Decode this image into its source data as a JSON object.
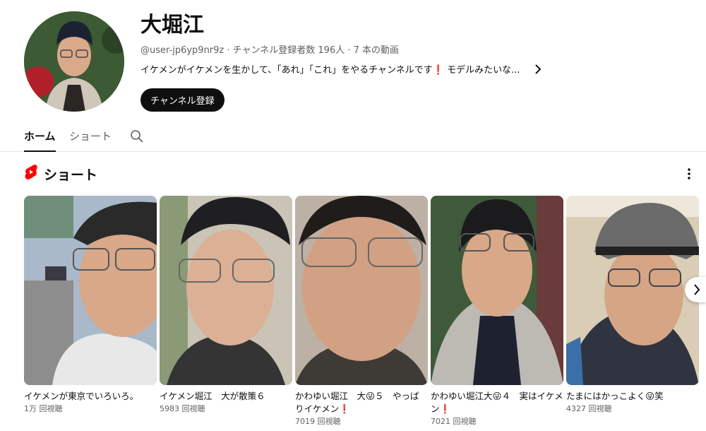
{
  "channel": {
    "name": "大堀江",
    "meta": "@user-jp6yp9nr9z · チャンネル登録者数 196人 · 7 本の動画",
    "description": "イケメンがイケメンを生かして、「あれ」「これ」をやるチャンネルです❗ モデルみたいな...",
    "more_icon": "chevron-right-icon",
    "subscribe_label": "チャンネル登録"
  },
  "tabs": [
    {
      "label": "ホーム",
      "active": true
    },
    {
      "label": "ショート",
      "active": false
    }
  ],
  "search_icon": "search-icon",
  "shorts_section": {
    "title": "ショート",
    "icon": "youtube-shorts-icon",
    "menu_icon": "more-vert-icon",
    "items": [
      {
        "title": "イケメンが東京でいろいろ。",
        "views": "1万 回視聴"
      },
      {
        "title": "イケメン堀江　大が散策６",
        "views": "5983 回視聴"
      },
      {
        "title": "かわゆい堀江　大😜５　やっぱりイケメン❗",
        "views": "7019 回視聴"
      },
      {
        "title": "かわゆい堀江大😜４　実はイケメン❗",
        "views": "7021 回視聴"
      },
      {
        "title": "たまにはかっこよく😜笑",
        "views": "4327 回視聴"
      }
    ],
    "next_icon": "chevron-right-icon"
  },
  "colors": {
    "accent": "#ff0000",
    "text": "#0f0f0f",
    "secondary": "#606060",
    "button_bg": "#0f0f0f"
  }
}
